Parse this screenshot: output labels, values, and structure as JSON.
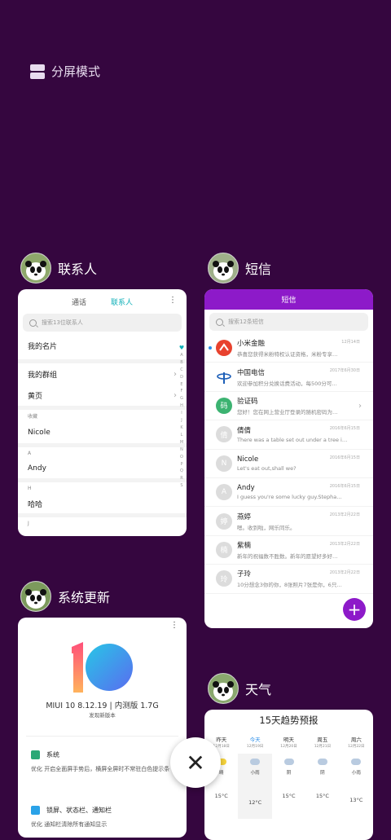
{
  "split_screen": {
    "label": "分屏模式",
    "icon": "split-screen-icon"
  },
  "contacts_app": {
    "title": "联系人",
    "tabs": [
      "通话",
      "联系人"
    ],
    "search_placeholder": "搜索13位联系人",
    "my_card": "我的名片",
    "groups": "我的群组",
    "yellow_pages": "黄页",
    "favorites_header": "收藏",
    "sections": [
      {
        "letter": "A",
        "name": "Andy"
      },
      {
        "letter": "H",
        "name": "哈哈"
      },
      {
        "letter": "J",
        "name": ""
      }
    ],
    "favorite": "Nicole",
    "index_letters": [
      "A",
      "B",
      "C",
      "D",
      "E",
      "F",
      "G",
      "H",
      "I",
      "J",
      "K",
      "L",
      "M",
      "N",
      "O",
      "P",
      "Q",
      "R",
      "S"
    ]
  },
  "sms_app": {
    "title": "短信",
    "header": "短信",
    "search_placeholder": "搜索12条短信",
    "messages": [
      {
        "name": "小米金融",
        "preview": "恭喜您获得米粉特权认证资格，米粉专享…",
        "date": "12月14日",
        "unread": true,
        "avatar_color": "#e8422e",
        "avatar": ""
      },
      {
        "name": "中国电信",
        "preview": "欢迎参加积分兑换话费活动，每500分可…",
        "date": "2017年6月30日",
        "unread": false,
        "avatar_color": "#ffffff",
        "avatar": ""
      },
      {
        "name": "验证码",
        "preview": "您好！您在网上营业厅登录的随机密码为…",
        "date": "",
        "unread": false,
        "avatar_color": "#3cb371",
        "avatar": "码"
      },
      {
        "name": "倩倩",
        "preview": "There was a table set out under a tree i…",
        "date": "2016年6月15日",
        "unread": false,
        "avatar_color": "#dcdcdc",
        "avatar": "倩"
      },
      {
        "name": "Nicole",
        "preview": "Let's eat out,shall we?",
        "date": "2016年6月15日",
        "unread": false,
        "avatar_color": "#dcdcdc",
        "avatar": "N"
      },
      {
        "name": "Andy",
        "preview": "I guess you're some lucky guy.Stepha…",
        "date": "2016年6月15日",
        "unread": false,
        "avatar_color": "#dcdcdc",
        "avatar": "A"
      },
      {
        "name": "燕婷",
        "preview": "嗯。收到啦，网乐同乐。",
        "date": "2013年2月22日",
        "unread": false,
        "avatar_color": "#dcdcdc",
        "avatar": "婷"
      },
      {
        "name": "紫楠",
        "preview": "新年的祝福数不胜数。新年的愿望好多好…",
        "date": "2013年2月22日",
        "unread": false,
        "avatar_color": "#dcdcdc",
        "avatar": "楠"
      },
      {
        "name": "子玲",
        "preview": "10分想念3你的你，8张照片7张是你，6只…",
        "date": "2013年2月22日",
        "unread": false,
        "avatar_color": "#dcdcdc",
        "avatar": "玲"
      }
    ],
    "fab": "+"
  },
  "update_app": {
    "title": "系统更新",
    "version": "MIUI 10 8.12.19 | 内测版 1.7G",
    "subtitle": "发现新版本",
    "items": [
      {
        "title": "系统",
        "desc": "优化 开启全面屏手势后，横屏全屏时不常驻白色提示条",
        "icon_color": "#2aa876"
      },
      {
        "title": "锁屏、状态栏、通知栏",
        "desc": "优化 通知栏清除所有通知显示",
        "icon_color": "#2aa2e8"
      }
    ],
    "more": "⋮"
  },
  "weather_app": {
    "title": "天气",
    "card_title": "15天趋势预报",
    "days": [
      {
        "name": "昨天",
        "date": "12月18日",
        "cond": "晴",
        "temp": "15°C",
        "icon_color": "#f7d43c"
      },
      {
        "name": "今天",
        "date": "12月19日",
        "cond": "小雨",
        "temp": "12°C",
        "icon_color": "#b9cbe0"
      },
      {
        "name": "明天",
        "date": "12月20日",
        "cond": "阴",
        "temp": "15°C",
        "icon_color": "#b9cbe0"
      },
      {
        "name": "周五",
        "date": "12月21日",
        "cond": "阴",
        "temp": "15°C",
        "icon_color": "#b9cbe0"
      },
      {
        "name": "周六",
        "date": "12月22日",
        "cond": "小雨",
        "temp": "13°C",
        "icon_color": "#b9cbe0"
      }
    ]
  },
  "close_button": "✕"
}
